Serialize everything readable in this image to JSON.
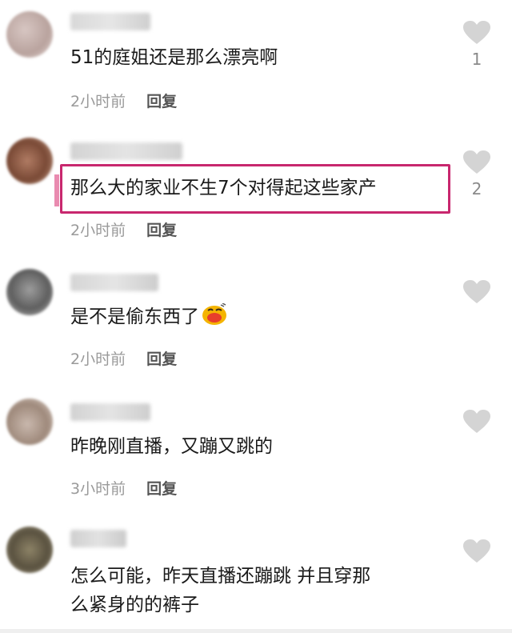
{
  "comments": [
    {
      "text": "51的庭姐还是那么漂亮啊",
      "time": "2小时前",
      "reply": "回复",
      "likes": "1"
    },
    {
      "text": "那么大的家业不生7个对得起这些家产",
      "time": "2小时前",
      "reply": "回复",
      "likes": "2"
    },
    {
      "text": "是不是偷东西了",
      "time": "2小时前",
      "reply": "回复",
      "likes": ""
    },
    {
      "text": "昨晚刚直播，又蹦又跳的",
      "time": "3小时前",
      "reply": "回复",
      "likes": ""
    },
    {
      "text_line1": "怎么可能，昨天直播还蹦跳 并且穿那",
      "text_line2": "么紧身的的裤子",
      "likes": ""
    }
  ],
  "icons": {
    "like": "heart-icon",
    "emoji": "smirking-face-emoji-icon"
  },
  "colors": {
    "highlight": "#c8276e",
    "heart": "#d4d4d4"
  }
}
